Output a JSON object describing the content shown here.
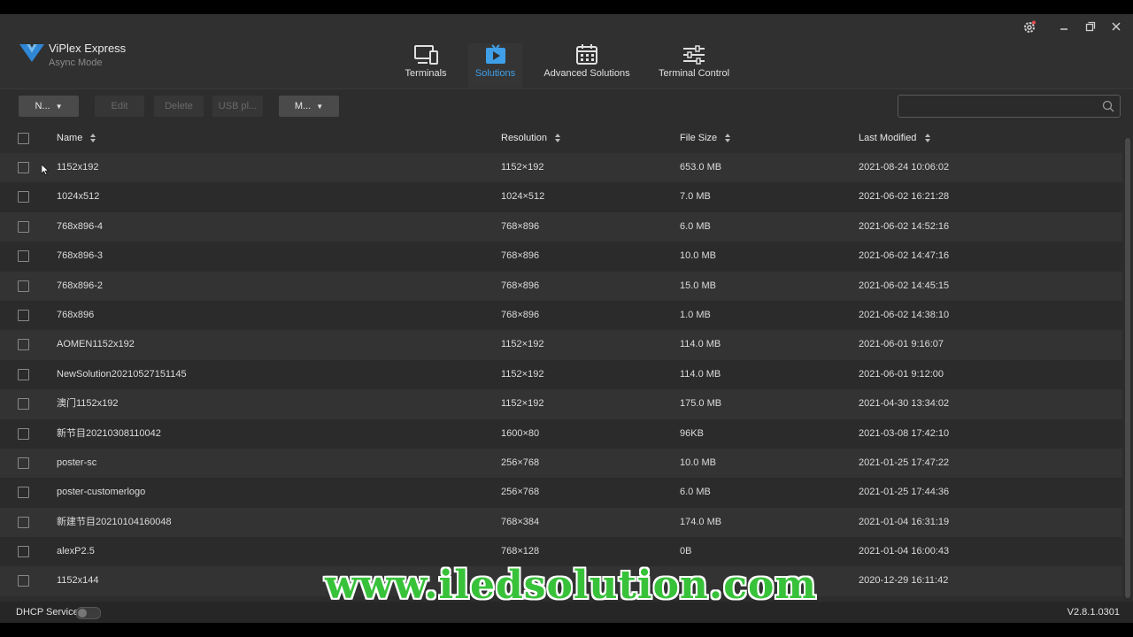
{
  "app": {
    "title": "ViPlex Express",
    "subtitle": "Async Mode",
    "version": "V2.8.1.0301",
    "accent_color": "#3f9fe8"
  },
  "nav": {
    "tabs": [
      {
        "label": "Terminals",
        "icon": "monitor-icon",
        "active": false
      },
      {
        "label": "Solutions",
        "icon": "play-icon",
        "active": true
      },
      {
        "label": "Advanced Solutions",
        "icon": "calendar-icon",
        "active": false
      },
      {
        "label": "Terminal Control",
        "icon": "sliders-icon",
        "active": false
      }
    ]
  },
  "window_controls": {
    "settings": "gear-icon",
    "minimize": "minimize-icon",
    "restore": "restore-icon",
    "close": "close-icon"
  },
  "toolbar": {
    "new_label": "N...",
    "edit_label": "Edit",
    "delete_label": "Delete",
    "usb_label": "USB pl...",
    "more_label": "M...",
    "search_placeholder": ""
  },
  "table": {
    "columns": [
      "Name",
      "Resolution",
      "File Size",
      "Last Modified"
    ],
    "rows": [
      {
        "name": "1152x192",
        "resolution": "1152×192",
        "size": "653.0 MB",
        "modified": "2021-08-24  10:06:02"
      },
      {
        "name": "1024x512",
        "resolution": "1024×512",
        "size": "7.0 MB",
        "modified": "2021-06-02  16:21:28"
      },
      {
        "name": "768x896-4",
        "resolution": "768×896",
        "size": "6.0 MB",
        "modified": "2021-06-02  14:52:16"
      },
      {
        "name": "768x896-3",
        "resolution": "768×896",
        "size": "10.0 MB",
        "modified": "2021-06-02  14:47:16"
      },
      {
        "name": "768x896-2",
        "resolution": "768×896",
        "size": "15.0 MB",
        "modified": "2021-06-02  14:45:15"
      },
      {
        "name": "768x896",
        "resolution": "768×896",
        "size": "1.0 MB",
        "modified": "2021-06-02  14:38:10"
      },
      {
        "name": "AOMEN1152x192",
        "resolution": "1152×192",
        "size": "114.0 MB",
        "modified": "2021-06-01  9:16:07"
      },
      {
        "name": "NewSolution20210527151145",
        "resolution": "1152×192",
        "size": "114.0 MB",
        "modified": "2021-06-01  9:12:00"
      },
      {
        "name": "澳门1152x192",
        "resolution": "1152×192",
        "size": "175.0 MB",
        "modified": "2021-04-30  13:34:02"
      },
      {
        "name": "新节目20210308110042",
        "resolution": "1600×80",
        "size": "96KB",
        "modified": "2021-03-08  17:42:10"
      },
      {
        "name": "poster-sc",
        "resolution": "256×768",
        "size": "10.0 MB",
        "modified": "2021-01-25  17:47:22"
      },
      {
        "name": "poster-customerlogo",
        "resolution": "256×768",
        "size": "6.0 MB",
        "modified": "2021-01-25  17:44:36"
      },
      {
        "name": "新建节目20210104160048",
        "resolution": "768×384",
        "size": "174.0 MB",
        "modified": "2021-01-04  16:31:19"
      },
      {
        "name": "alexP2.5",
        "resolution": "768×128",
        "size": "0B",
        "modified": "2021-01-04  16:00:43"
      },
      {
        "name": "1152x144",
        "resolution": "",
        "size": "",
        "modified": "2020-12-29  16:11:42"
      }
    ]
  },
  "status": {
    "dhcp_label": "DHCP Service",
    "dhcp_on": false
  },
  "watermark": "www.iledsolution.com"
}
